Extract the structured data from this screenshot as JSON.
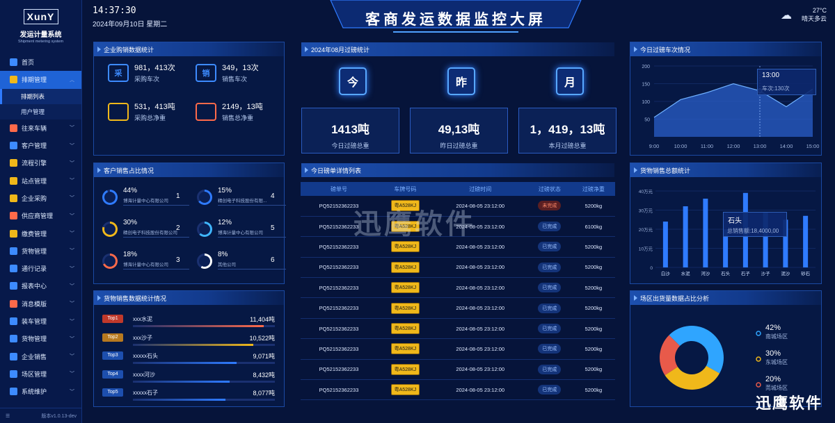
{
  "app": {
    "logo": "XunY",
    "system_title": "发运计量系统",
    "system_subtitle": "Shipment metering system",
    "version": "版本v1.0.13-dev"
  },
  "sidebar": {
    "items": [
      {
        "label": "首页",
        "icon": "home-icon",
        "color": "#3d8bff",
        "expandable": false
      },
      {
        "label": "排期管理",
        "icon": "calendar-icon",
        "color": "#f0b81a",
        "expandable": true,
        "active": true
      },
      {
        "label": "往来车辆",
        "icon": "truck-icon",
        "color": "#ff6a4a",
        "expandable": true
      },
      {
        "label": "客户管理",
        "icon": "user-icon",
        "color": "#3d8bff",
        "expandable": true
      },
      {
        "label": "流程引擎",
        "icon": "flow-icon",
        "color": "#f0b81a",
        "expandable": true
      },
      {
        "label": "站点管理",
        "icon": "site-icon",
        "color": "#f0b81a",
        "expandable": true
      },
      {
        "label": "企业采购",
        "icon": "purchase-icon",
        "color": "#f0b81a",
        "expandable": true
      },
      {
        "label": "供应商管理",
        "icon": "supplier-icon",
        "color": "#ff6a4a",
        "expandable": true
      },
      {
        "label": "缴费管理",
        "icon": "payment-icon",
        "color": "#f0b81a",
        "expandable": true
      },
      {
        "label": "货物管理",
        "icon": "goods-icon",
        "color": "#3d8bff",
        "expandable": true
      },
      {
        "label": "通行记录",
        "icon": "record-icon",
        "color": "#3d8bff",
        "expandable": true
      },
      {
        "label": "报表中心",
        "icon": "report-icon",
        "color": "#3d8bff",
        "expandable": true
      },
      {
        "label": "消息模版",
        "icon": "bell-icon",
        "color": "#ff6a4a",
        "expandable": true
      },
      {
        "label": "装车管理",
        "icon": "loading-icon",
        "color": "#3d8bff",
        "expandable": true
      },
      {
        "label": "货物管理",
        "icon": "box-icon",
        "color": "#3d8bff",
        "expandable": true
      },
      {
        "label": "企业销售",
        "icon": "sales-icon",
        "color": "#3d8bff",
        "expandable": true
      },
      {
        "label": "场区管理",
        "icon": "yard-icon",
        "color": "#3d8bff",
        "expandable": true
      },
      {
        "label": "系统维护",
        "icon": "settings-icon",
        "color": "#3d8bff",
        "expandable": true
      }
    ],
    "sub_items": [
      {
        "label": "排期列表",
        "active": true
      },
      {
        "label": "用户管理",
        "active": false
      }
    ]
  },
  "header": {
    "time": "14:37:30",
    "date": "2024年09月10日 星期二",
    "title": "客商发运数据监控大屏",
    "temperature": "27°C",
    "weather": "晴天多云"
  },
  "purchase_sales": {
    "title": "企业购销数据统计",
    "stats": [
      {
        "icon_text": "采",
        "value": "981，413次",
        "label": "采购车次",
        "color": "#3d8bff"
      },
      {
        "icon_text": "销",
        "value": "349，13次",
        "label": "销售车次",
        "color": "#3d8bff"
      },
      {
        "icon_text": "",
        "value": "531，413吨",
        "label": "采购总净重",
        "color": "#f0b81a"
      },
      {
        "icon_text": "",
        "value": "2149，13吨",
        "label": "销售总净重",
        "color": "#ff6a4a"
      }
    ]
  },
  "customer_share": {
    "title": "客户销售占比情况",
    "items": [
      {
        "pct": "44%",
        "pct_value": 44,
        "name": "博海计量中心有限公司",
        "rank": "1",
        "color": "#2f7bff"
      },
      {
        "pct": "15%",
        "pct_value": 15,
        "name": "精创电子科技股份有限...",
        "rank": "4",
        "color": "#2f7bff"
      },
      {
        "pct": "30%",
        "pct_value": 30,
        "name": "精创电子科技股份有限公司",
        "rank": "2",
        "color": "#f0b81a"
      },
      {
        "pct": "12%",
        "pct_value": 12,
        "name": "博海计量中心有限公司",
        "rank": "5",
        "color": "#3fb6ff"
      },
      {
        "pct": "18%",
        "pct_value": 18,
        "name": "博海计量中心有限公司",
        "rank": "3",
        "color": "#ff6a4a"
      },
      {
        "pct": "8%",
        "pct_value": 8,
        "name": "其他公司",
        "rank": "6",
        "color": "#ffffff"
      }
    ]
  },
  "goods_sales": {
    "title": "货物销售数据统计情况",
    "items": [
      {
        "badge": "Top1",
        "name": "xxx水泥",
        "value": "11,404吨",
        "fill": 0.92,
        "color": "#ff6a4a",
        "badge_color": "#c0392b"
      },
      {
        "badge": "Top2",
        "name": "xxx沙子",
        "value": "10,522吨",
        "fill": 0.85,
        "color": "#f0b81a",
        "badge_color": "#b7791f"
      },
      {
        "badge": "Top3",
        "name": "xxxxx石头",
        "value": "9,071吨",
        "fill": 0.73,
        "color": "#2f7bff",
        "badge_color": "#1d4fae"
      },
      {
        "badge": "Top4",
        "name": "xxxx河沙",
        "value": "8,432吨",
        "fill": 0.68,
        "color": "#2f7bff",
        "badge_color": "#1d4fae"
      },
      {
        "badge": "Top5",
        "name": "xxxxx石子",
        "value": "8,077吨",
        "fill": 0.65,
        "color": "#2f7bff",
        "badge_color": "#1d4fae"
      }
    ]
  },
  "monthly": {
    "title": "2024年08月过磅统计",
    "cards": [
      {
        "cal": "今",
        "value": "1413吨",
        "label": "今日过磅总重"
      },
      {
        "cal": "昨",
        "value": "49,13吨",
        "label": "昨日过磅总重"
      },
      {
        "cal": "月",
        "value": "1，419，13吨",
        "label": "本月过磅总重"
      }
    ]
  },
  "weigh_list": {
    "title": "今日磅单详情列表",
    "columns": [
      "磅单号",
      "车牌号码",
      "过磅时间",
      "过磅状态",
      "过磅净重"
    ],
    "rows": [
      {
        "no": "PQ52152362233",
        "plate": "粤A528KJ",
        "time": "2024-08-05 23:12:00",
        "status": "未完成",
        "done": false,
        "weight": "5200kg"
      },
      {
        "no": "PQ52152362233",
        "plate": "粤A528KJ",
        "time": "2024-08-05 23:12:00",
        "status": "已完成",
        "done": true,
        "weight": "6100kg"
      },
      {
        "no": "PQ52152362233",
        "plate": "粤A528KJ",
        "time": "2024-08-05 23:12:00",
        "status": "已完成",
        "done": true,
        "weight": "5200kg"
      },
      {
        "no": "PQ52152362233",
        "plate": "粤A528KJ",
        "time": "2024-08-05 23:12:00",
        "status": "已完成",
        "done": true,
        "weight": "5200kg"
      },
      {
        "no": "PQ52152362233",
        "plate": "粤A528KJ",
        "time": "2024-08-05 23:12:00",
        "status": "已完成",
        "done": true,
        "weight": "5200kg"
      },
      {
        "no": "PQ52152362233",
        "plate": "粤A528KJ",
        "time": "2024-08-05 23:12:00",
        "status": "已完成",
        "done": true,
        "weight": "5200kg"
      },
      {
        "no": "PQ52152362233",
        "plate": "粤A528KJ",
        "time": "2024-08-05 23:12:00",
        "status": "已完成",
        "done": true,
        "weight": "5200kg"
      },
      {
        "no": "PQ52152362233",
        "plate": "粤A528KJ",
        "time": "2024-08-05 23:12:00",
        "status": "已完成",
        "done": true,
        "weight": "5200kg"
      },
      {
        "no": "PQ52152362233",
        "plate": "粤A528KJ",
        "time": "2024-08-05 23:12:00",
        "status": "已完成",
        "done": true,
        "weight": "5200kg"
      },
      {
        "no": "PQ52152362233",
        "plate": "粤A528KJ",
        "time": "2024-08-05 23:12:00",
        "status": "已完成",
        "done": true,
        "weight": "5200kg"
      }
    ]
  },
  "truck_trend": {
    "title": "今日过磅车次情况",
    "tooltip_time": "13:00",
    "tooltip_text": "车次:130次",
    "chart_data": {
      "type": "area",
      "x": [
        "9:00",
        "10:00",
        "11:00",
        "12:00",
        "13:00",
        "14:00",
        "15:00"
      ],
      "values": [
        55,
        105,
        125,
        150,
        130,
        85,
        135
      ],
      "ylim": [
        0,
        200
      ],
      "yticks": [
        "200",
        "150",
        "100",
        "50"
      ]
    }
  },
  "goods_amount": {
    "title": "货物销售总额统计",
    "tooltip_name": "石头",
    "tooltip_text": "总销售额:18,4000,00",
    "chart_data": {
      "type": "bar",
      "categories": [
        "白沙",
        "水泥",
        "河沙",
        "石头",
        "石子",
        "沙子",
        "泥沙",
        "砂石"
      ],
      "values": [
        24,
        32,
        36,
        20,
        39,
        29,
        25,
        27
      ],
      "ylim": [
        0,
        40
      ],
      "yticks": [
        "40万元",
        "30万元",
        "20万元",
        "10万元",
        "0"
      ]
    }
  },
  "yard_share": {
    "title": "场区出货量数据占比分析",
    "chart_data": {
      "type": "pie",
      "slices": [
        {
          "label": "南城场区",
          "pct": "42%",
          "value": 42,
          "color": "#2fa5ff"
        },
        {
          "label": "东城场区",
          "pct": "30%",
          "value": 30,
          "color": "#f0b81a"
        },
        {
          "label": "莞城场区",
          "pct": "20%",
          "value": 20,
          "color": "#e85a4a"
        }
      ]
    }
  },
  "watermark": {
    "center": "迅鹰软件",
    "corner": "迅鹰软件"
  }
}
